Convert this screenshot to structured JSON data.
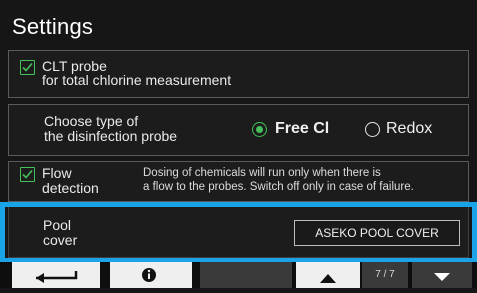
{
  "header": {
    "title": "Settings"
  },
  "clt_probe": {
    "checked": true,
    "line1": "CLT probe",
    "line2": "for total chlorine measurement"
  },
  "disinfection": {
    "line1": "Choose type of",
    "line2": "the disinfection probe",
    "options": [
      {
        "label": "Free Cl",
        "selected": true
      },
      {
        "label": "Redox",
        "selected": false
      }
    ]
  },
  "flow_detection": {
    "checked": true,
    "line1": "Flow",
    "line2": "detection",
    "note1": "Dosing of chemicals will run only when there is",
    "note2": "a flow to the probes. Switch off only in case of failure."
  },
  "pool_cover": {
    "line1": "Pool",
    "line2": "cover",
    "button": "ASEKO POOL COVER"
  },
  "footer": {
    "page": "7 / 7",
    "icons": [
      "back-icon",
      "info-icon",
      "up-arrow-icon",
      "down-arrow-icon"
    ]
  },
  "colors": {
    "accent_green": "#44c25a",
    "highlight_blue": "#1aa3e6"
  }
}
